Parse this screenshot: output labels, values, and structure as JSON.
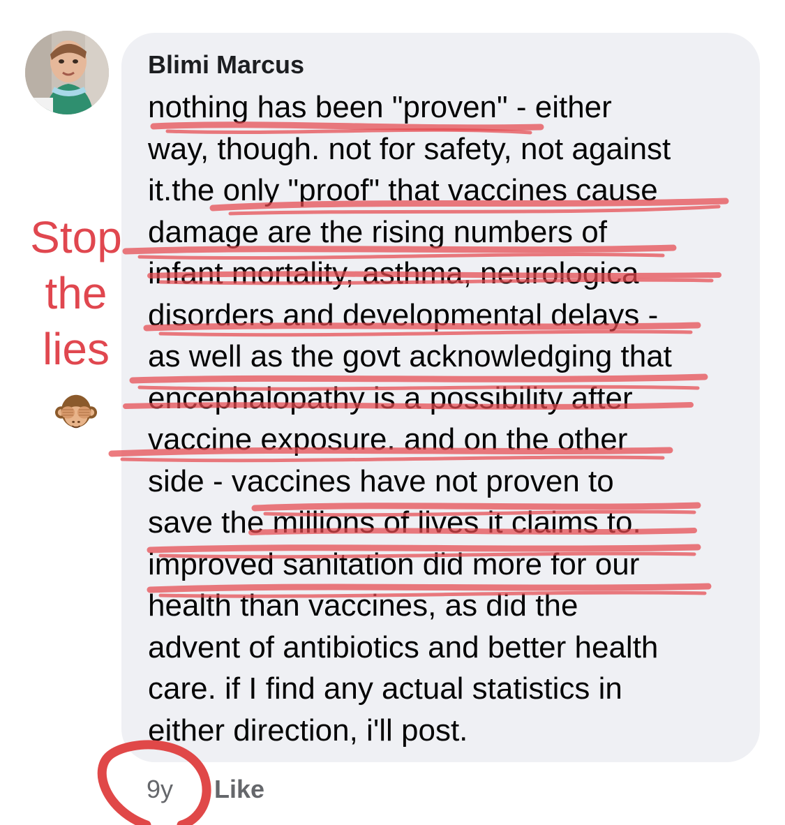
{
  "comment": {
    "author": "Blimi Marcus",
    "lines": [
      "nothing has been \"proven\" - either",
      "way, though. not for safety, not against",
      "it.the only \"proof\" that vaccines cause",
      "damage are the rising numbers of",
      "infant mortality, asthma, neurologica",
      "disorders and developmental delays -",
      "as well as the govt acknowledging that",
      "encephalopathy is a possibility after",
      "vaccine exposure. and on the other",
      "side - vaccines have not proven to",
      "save the millions of lives it claims to.",
      "improved sanitation did more for our",
      "health than vaccines, as did the",
      "advent of antibiotics and better health",
      "care. if I find any actual statistics in",
      "either direction, i'll post."
    ],
    "time": "9y",
    "like_label": "Like"
  },
  "annotation": {
    "lines": [
      "Stop",
      "the",
      "lies"
    ],
    "emoji_icon": "see-no-evil-monkey-icon",
    "color": "#e0474f"
  },
  "colors": {
    "bubble": "#eff0f4",
    "meta_text": "#65676b",
    "scribble": "#e5484d"
  }
}
